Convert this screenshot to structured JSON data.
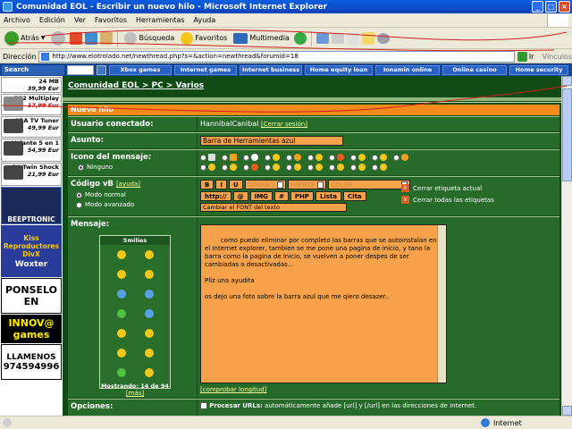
{
  "window": {
    "title": "Comunidad EOL - Escribir un nuevo hilo - Microsoft Internet Explorer"
  },
  "menu": [
    "Archivo",
    "Edición",
    "Ver",
    "Favoritos",
    "Herramientas",
    "Ayuda"
  ],
  "toolbar": {
    "back": "Atrás",
    "search": "Búsqueda",
    "favorites": "Favoritos",
    "multimedia": "Multimedia"
  },
  "address": {
    "label": "Dirección",
    "url": "http://www.elotrolado.net/newthread.php?s=&action=newthread&forumid=18",
    "go": "Ir",
    "links": "Vínculos"
  },
  "linkbar": {
    "search_label": "Search",
    "links": [
      "Xbox games",
      "Internet games",
      "Internet business",
      "Home equity loan",
      "Ionamin online",
      "Online casino",
      "Home security"
    ]
  },
  "ads": {
    "a1": "24 MB",
    "a1p": "39,99 Eur",
    "a2": "PS2 Multiplay",
    "a2p": "17,99 Eur",
    "a3": "GBA TV Tuner",
    "a3p": "49,99 Eur",
    "a4": "Volante 5 en 1",
    "a4p": "54,99 Eur",
    "a5": "PC Twin Shock",
    "a5p": "21,99 Eur",
    "beeptronic": "BEEPTRONIC",
    "kiss": "Kiss Reproductores DivX",
    "woxter": "Woxter",
    "ponselo": "PONSELO EN",
    "innova": "INNOV@ games",
    "llamenos": "LLAMENOS",
    "phone": "974594996"
  },
  "forum": {
    "breadcrumb": "Comunidad EOL > PC > Varios",
    "section": "Nuevo hilo",
    "user_label": "Usuario conectado:",
    "user_name": "HannibalCanibal",
    "logout": "[Cerrar sesión]",
    "subject_label": "Asunto:",
    "subject_value": "Barra de Herramientas azul",
    "icon_label": "Icono del mensaje:",
    "icon_none": "Ninguno",
    "vb_label": "Código vB",
    "vb_help": "[ayuda]",
    "mode_normal": "Modo normal",
    "mode_advanced": "Modo avanzado",
    "vb_size": "TAMAÑO",
    "vb_font": "FUENTE",
    "vb_color": "COLOR",
    "vb_buttons": [
      "B",
      "I",
      "U"
    ],
    "vb_buttons2": [
      "http://",
      "@",
      "IMG",
      "#",
      "PHP",
      "Lista",
      "Cita"
    ],
    "vb_change_font": "Cambiar el FONT del texto",
    "close_current": "Cerrar etiqueta actual",
    "close_all": "Cerrar todas las etiquetas",
    "message_label": "Mensaje:",
    "smilies_title": "Smilies",
    "smilies_showing": "Mostrando: 14 de 94",
    "smilies_more": "[más]",
    "message_text": "como puedo eliminar por completo las barras que se autoinstalan en el Internet explorer, tambien se me pone una pagina de inicio, y tano la barra como la pagina de inicio, se vuelven a poner despes de ser cambiadas o desactivadas...\n\nPliz una ayudita\n\nos dejo una foto sobre la barra azul que me qiero desazer..",
    "check_length": "[comprobar longitud]",
    "options_label": "Opciones:",
    "parse_urls_label": "Procesar URLs:",
    "parse_urls_desc": "automáticamente añade [url] y [/url] en las direcciones de internet."
  },
  "status": {
    "zone": "Internet"
  },
  "colors": {
    "forum_bg": "#104a14",
    "cell_bg": "#276b2a",
    "accent": "#f28b1b",
    "field": "#f6a24a"
  }
}
